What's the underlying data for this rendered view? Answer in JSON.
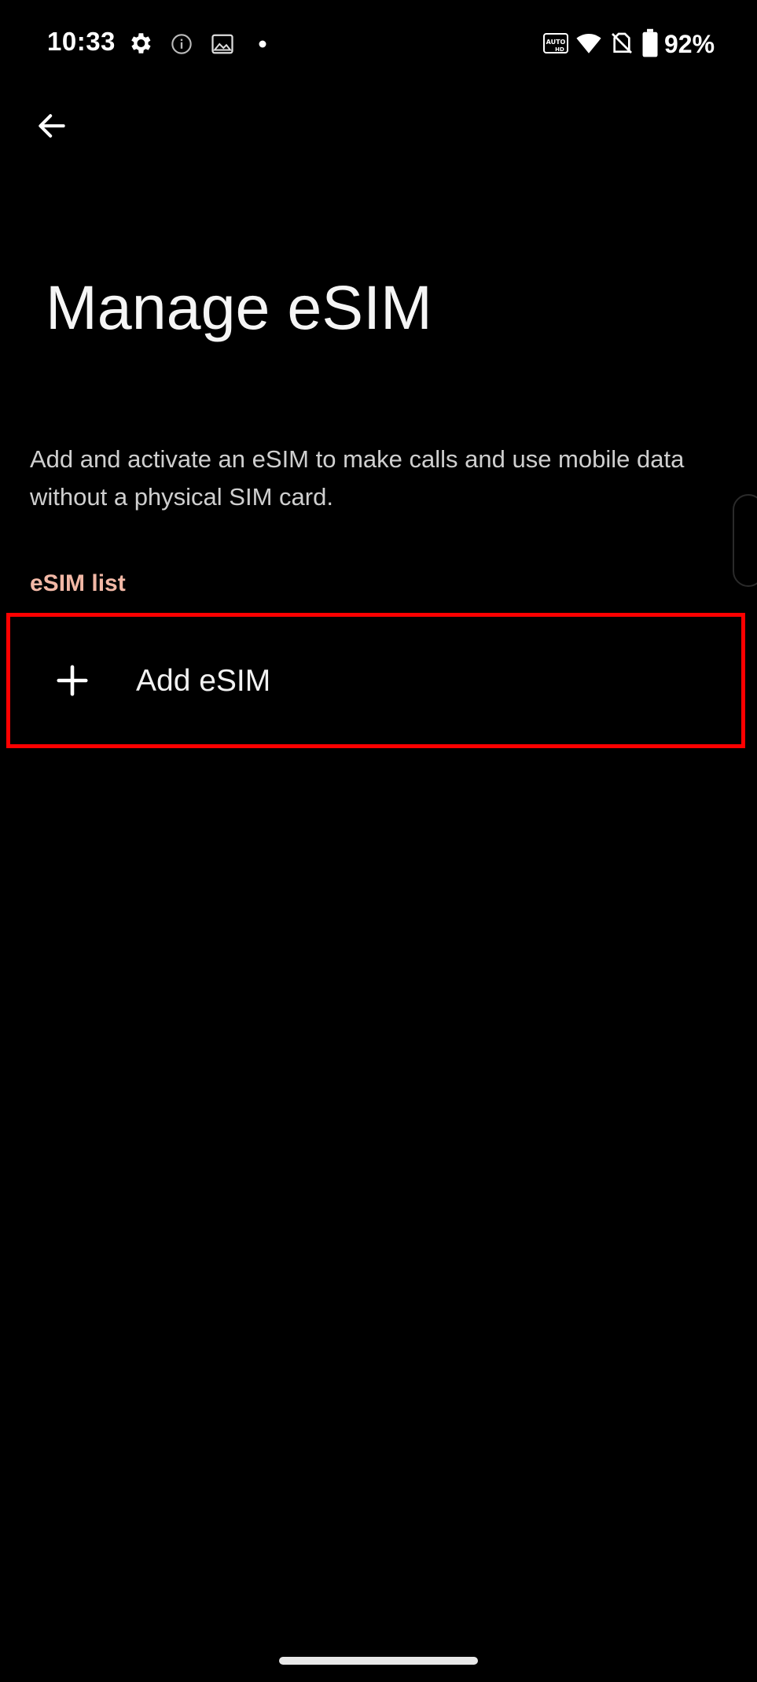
{
  "status_bar": {
    "time": "10:33",
    "battery_percent": "92%",
    "icons": [
      "gear-icon",
      "info-icon",
      "image-icon",
      "dot-icon",
      "auto-hd-icon",
      "wifi-icon",
      "no-sim-icon",
      "battery-icon"
    ]
  },
  "header": {
    "back_icon": "arrow-left-icon",
    "title": "Manage eSIM"
  },
  "main": {
    "description": "Add and activate an eSIM to make calls and use mobile data without a physical SIM card.",
    "section_header": "eSIM list",
    "add_item": {
      "icon": "plus-icon",
      "label": "Add eSIM"
    }
  },
  "colors": {
    "background": "#000000",
    "accent_section": "#f2b8a6",
    "highlight_border": "#ff0000"
  }
}
